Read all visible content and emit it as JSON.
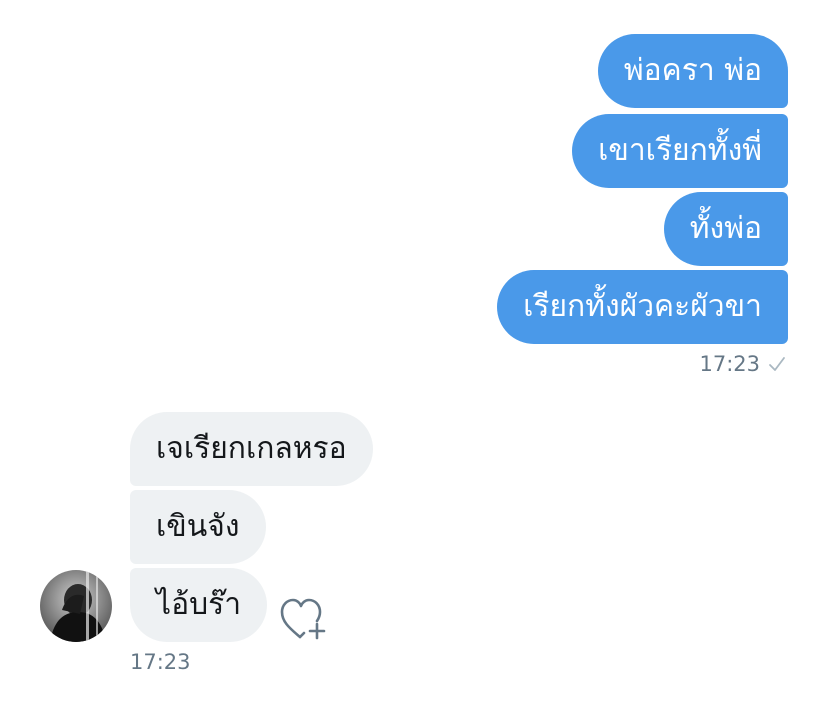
{
  "conversation": {
    "sent_messages": [
      {
        "text": "พ่อครา พ่อ"
      },
      {
        "text": "เขาเรียกทั้งพี่"
      },
      {
        "text": "ทั้งพ่อ"
      },
      {
        "text": "เรียกทั้งผัวคะผัวขา"
      }
    ],
    "sent_time": "17:23",
    "received_messages": [
      {
        "text": "เจเรียกเกลหรอ"
      },
      {
        "text": "เขินจัง"
      },
      {
        "text": "ไอ้บร๊า"
      }
    ],
    "received_time": "17:23"
  },
  "colors": {
    "sent_bubble": "#4a99e9",
    "received_bubble": "#eef1f3",
    "timestamp": "#657786"
  },
  "icons": {
    "read_receipt": "check-icon",
    "like": "heart-plus-icon"
  }
}
